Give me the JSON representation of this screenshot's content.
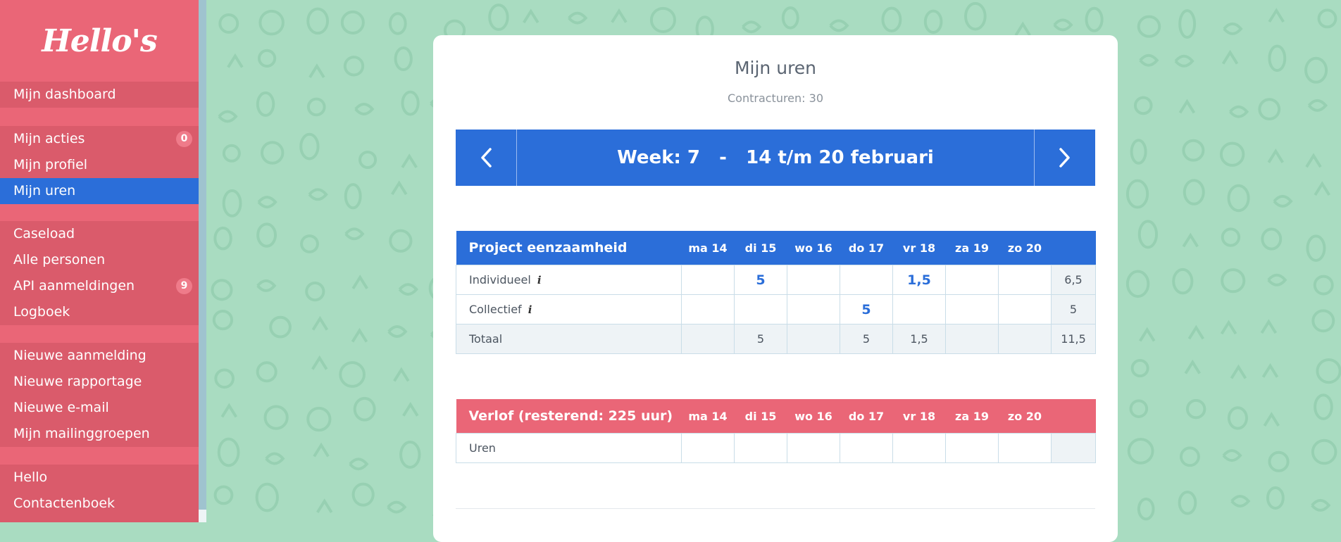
{
  "sidebar": {
    "logo": "Hello's",
    "groups": [
      {
        "items": [
          {
            "label": "Mijn dashboard"
          }
        ]
      },
      {
        "items": [
          {
            "label": "Mijn acties",
            "badge": "0"
          },
          {
            "label": "Mijn profiel"
          },
          {
            "label": "Mijn uren",
            "active": true
          }
        ]
      },
      {
        "items": [
          {
            "label": "Caseload"
          },
          {
            "label": "Alle personen"
          },
          {
            "label": "API aanmeldingen",
            "badge": "9"
          },
          {
            "label": "Logboek"
          }
        ]
      },
      {
        "items": [
          {
            "label": "Nieuwe aanmelding"
          },
          {
            "label": "Nieuwe rapportage"
          },
          {
            "label": "Nieuwe e-mail"
          },
          {
            "label": "Mijn mailinggroepen"
          }
        ]
      },
      {
        "items": [
          {
            "label": "Hello"
          },
          {
            "label": "Contactenboek"
          }
        ]
      }
    ]
  },
  "page": {
    "title": "Mijn uren",
    "subtitle": "Contracturen: 30"
  },
  "week": {
    "label": "Week: 7   -   14 t/m 20 februari"
  },
  "days": [
    "ma 14",
    "di 15",
    "wo 16",
    "do 17",
    "vr 18",
    "za 19",
    "zo 20"
  ],
  "project_table": {
    "title": "Project eenzaamheid",
    "rows": [
      {
        "label": "Individueel",
        "info": "i",
        "cells": [
          "",
          "5",
          "",
          "",
          "1,5",
          "",
          ""
        ],
        "total": "6,5"
      },
      {
        "label": "Collectief",
        "info": "i",
        "cells": [
          "",
          "",
          "",
          "5",
          "",
          "",
          ""
        ],
        "total": "5"
      },
      {
        "label": "Totaal",
        "cells": [
          "",
          "5",
          "",
          "5",
          "1,5",
          "",
          ""
        ],
        "total": "11,5"
      }
    ]
  },
  "leave_table": {
    "title": "Verlof (resterend: 225 uur)",
    "rows": [
      {
        "label": "Uren",
        "cells": [
          "",
          "",
          "",
          "",
          "",
          "",
          ""
        ],
        "total": ""
      }
    ]
  },
  "colors": {
    "sidebar": "#ea6677",
    "accent": "#2b6ed9",
    "background": "#a9dcc1"
  }
}
